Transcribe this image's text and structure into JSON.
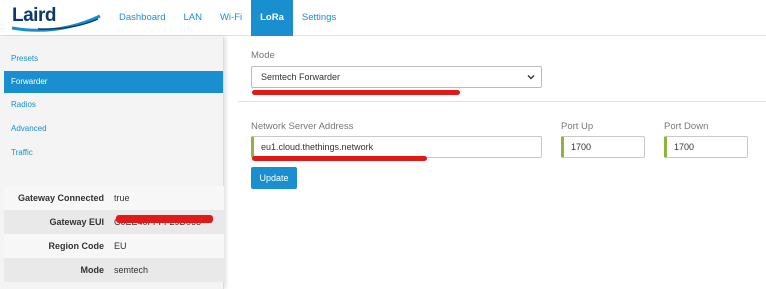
{
  "brand": {
    "logo_text": "Laird"
  },
  "nav": {
    "items": [
      {
        "label": "Dashboard"
      },
      {
        "label": "LAN"
      },
      {
        "label": "Wi-Fi"
      },
      {
        "label": "LoRa",
        "active": true
      },
      {
        "label": "Settings"
      }
    ]
  },
  "sidebar": {
    "items": [
      {
        "label": "Presets"
      },
      {
        "label": "Forwarder",
        "active": true
      },
      {
        "label": "Radios"
      },
      {
        "label": "Advanced"
      },
      {
        "label": "Traffic"
      }
    ],
    "status": [
      {
        "key": "Gateway Connected",
        "value": "true"
      },
      {
        "key": "Gateway EUI",
        "value": "C0EE40FFFF29D068"
      },
      {
        "key": "Region Code",
        "value": "EU"
      },
      {
        "key": "Mode",
        "value": "semtech"
      }
    ]
  },
  "form": {
    "mode_label": "Mode",
    "mode_value": "Semtech Forwarder",
    "server_label": "Network Server Address",
    "server_value": "eu1.cloud.thethings.network",
    "port_up_label": "Port Up",
    "port_up_value": "1700",
    "port_down_label": "Port Down",
    "port_down_value": "1700",
    "update_label": "Update"
  },
  "colors": {
    "accent": "#1a8fd0",
    "input_border_ok": "#8fb33b",
    "annotation": "#e01919"
  },
  "icons": {
    "dropdown": "chevron-down-icon",
    "logo_swoosh": "swoosh-icon"
  }
}
